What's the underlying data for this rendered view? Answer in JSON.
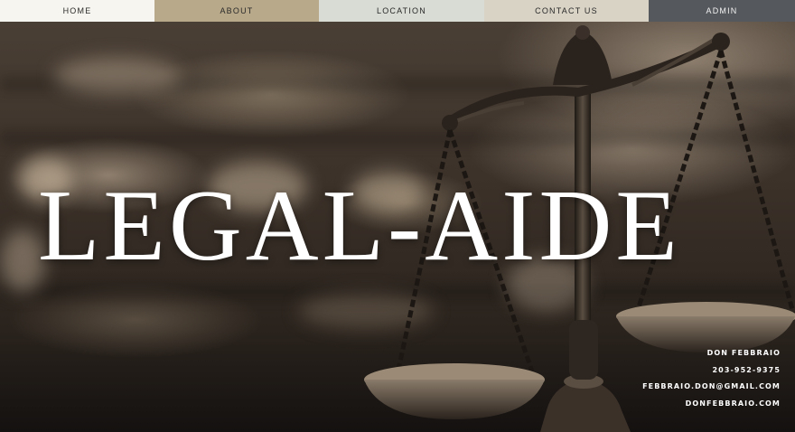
{
  "nav": {
    "home": "HOME",
    "about": "ABOUT",
    "location": "LOCATION",
    "contact": "CONTACT US",
    "admin": "ADMIN"
  },
  "hero": {
    "title": "LEGAL-AIDE",
    "contact": {
      "name": "DON FEBBRAIO",
      "phone": "203-952-9375",
      "email": "FEBBRAIO.DON@GMAIL.COM",
      "website": "DONFEBBRAIO.COM"
    }
  },
  "colors": {
    "home_bg": "#f7f5ef",
    "about_bg": "#b8a98a",
    "location_bg": "#d8dcd4",
    "contact_bg": "#d9d3c6",
    "admin_bg": "#55585d"
  }
}
